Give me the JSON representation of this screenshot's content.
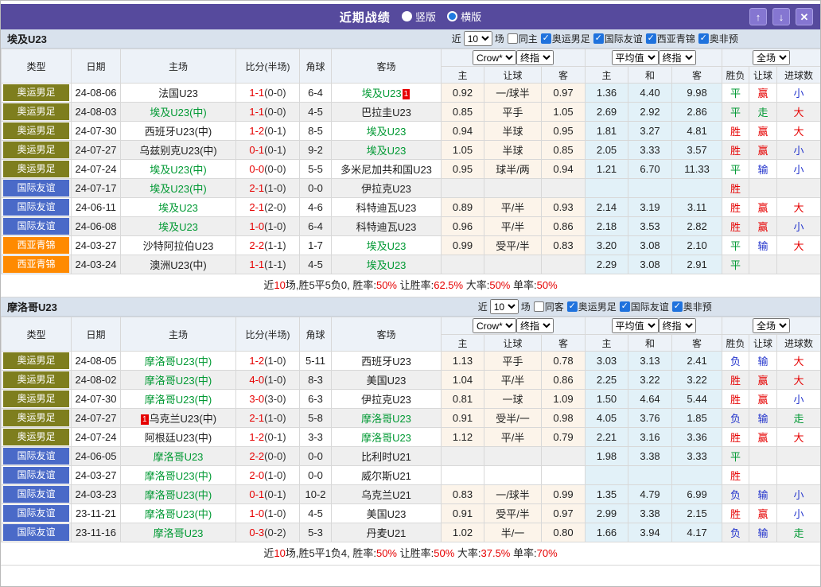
{
  "title_bar": {
    "title": "近期战绩",
    "radio_vertical": "竖版",
    "radio_horizontal": "横版",
    "up_icon": "↑",
    "down_icon": "↓",
    "close_icon": "✕"
  },
  "colors": {
    "titlebar_purple": "#564a9d",
    "button_purple": "#8576d1",
    "type_olympic": "#7e7e1e",
    "type_friendly": "#4a6ac8",
    "type_wasia": "#ff8a00",
    "team_green": "#009933",
    "score_red": "#e60000",
    "loss_blue": "#2233cc",
    "handicap_bg": "#fcf4ea",
    "avg_bg": "#e2f1f8"
  },
  "table_headers": {
    "type": "类型",
    "date": "日期",
    "home": "主场",
    "score": "比分(半场)",
    "corner": "角球",
    "away": "客场",
    "sub_home": "主",
    "sub_handicap": "让球",
    "sub_away": "客",
    "sub_home2": "主",
    "sub_draw": "和",
    "sub_away2": "客",
    "sub_result": "胜负",
    "sub_handicap2": "让球",
    "sub_goals": "进球数",
    "select_crow": "Crow*",
    "select_final_1": "终指",
    "select_avg": "平均值",
    "select_final_2": "终指",
    "select_full": "全场"
  },
  "sections": [
    {
      "team": "埃及U23",
      "filter": {
        "near_label": "近",
        "count": "10",
        "games_label": "场",
        "same_label": "同主",
        "same_checked": false,
        "competitions": [
          "奥运男足",
          "国际友谊",
          "西亚青锦",
          "奥非预"
        ]
      },
      "rows": [
        {
          "type": "奥运男足",
          "tc": "olive",
          "date": "24-08-06",
          "home": "法国U23",
          "hg": false,
          "hb": "",
          "score": "1-1",
          "half": "(0-0)",
          "corner": "6-4",
          "away": "埃及U23",
          "ag": true,
          "ab": "1",
          "odds": [
            "0.92",
            "一/球半",
            "0.97"
          ],
          "avg": [
            "1.36",
            "4.40",
            "9.98"
          ],
          "res": [
            [
              "平",
              "g"
            ],
            [
              "赢",
              "r"
            ],
            [
              "小",
              "b"
            ]
          ]
        },
        {
          "type": "奥运男足",
          "tc": "olive",
          "date": "24-08-03",
          "home": "埃及U23(中)",
          "hg": true,
          "hb": "",
          "score": "1-1",
          "half": "(0-0)",
          "corner": "4-5",
          "away": "巴拉圭U23",
          "ag": false,
          "ab": "",
          "odds": [
            "0.85",
            "平手",
            "1.05"
          ],
          "avg": [
            "2.69",
            "2.92",
            "2.86"
          ],
          "res": [
            [
              "平",
              "g"
            ],
            [
              "走",
              "g"
            ],
            [
              "大",
              "r"
            ]
          ]
        },
        {
          "type": "奥运男足",
          "tc": "olive",
          "date": "24-07-30",
          "home": "西班牙U23(中)",
          "hg": false,
          "hb": "",
          "score": "1-2",
          "half": "(0-1)",
          "corner": "8-5",
          "away": "埃及U23",
          "ag": true,
          "ab": "",
          "odds": [
            "0.94",
            "半球",
            "0.95"
          ],
          "avg": [
            "1.81",
            "3.27",
            "4.81"
          ],
          "res": [
            [
              "胜",
              "r"
            ],
            [
              "赢",
              "r"
            ],
            [
              "大",
              "r"
            ]
          ]
        },
        {
          "type": "奥运男足",
          "tc": "olive",
          "date": "24-07-27",
          "home": "乌兹别克U23(中)",
          "hg": false,
          "hb": "",
          "score": "0-1",
          "half": "(0-1)",
          "corner": "9-2",
          "away": "埃及U23",
          "ag": true,
          "ab": "",
          "odds": [
            "1.05",
            "半球",
            "0.85"
          ],
          "avg": [
            "2.05",
            "3.33",
            "3.57"
          ],
          "res": [
            [
              "胜",
              "r"
            ],
            [
              "赢",
              "r"
            ],
            [
              "小",
              "b"
            ]
          ]
        },
        {
          "type": "奥运男足",
          "tc": "olive",
          "date": "24-07-24",
          "home": "埃及U23(中)",
          "hg": true,
          "hb": "",
          "score": "0-0",
          "half": "(0-0)",
          "corner": "5-5",
          "away": "多米尼加共和国U23",
          "ag": false,
          "ab": "",
          "odds": [
            "0.95",
            "球半/两",
            "0.94"
          ],
          "avg": [
            "1.21",
            "6.70",
            "11.33"
          ],
          "res": [
            [
              "平",
              "g"
            ],
            [
              "输",
              "b"
            ],
            [
              "小",
              "b"
            ]
          ]
        },
        {
          "type": "国际友谊",
          "tc": "blue",
          "date": "24-07-17",
          "home": "埃及U23(中)",
          "hg": true,
          "hb": "",
          "score": "2-1",
          "half": "(1-0)",
          "corner": "0-0",
          "away": "伊拉克U23",
          "ag": false,
          "ab": "",
          "odds": [
            "",
            "",
            ""
          ],
          "avg": [
            "",
            "",
            ""
          ],
          "res": [
            [
              "胜",
              "r"
            ],
            [
              "",
              ""
            ],
            [
              "",
              ""
            ]
          ]
        },
        {
          "type": "国际友谊",
          "tc": "blue",
          "date": "24-06-11",
          "home": "埃及U23",
          "hg": true,
          "hb": "",
          "score": "2-1",
          "half": "(2-0)",
          "corner": "4-6",
          "away": "科特迪瓦U23",
          "ag": false,
          "ab": "",
          "odds": [
            "0.89",
            "平/半",
            "0.93"
          ],
          "avg": [
            "2.14",
            "3.19",
            "3.11"
          ],
          "res": [
            [
              "胜",
              "r"
            ],
            [
              "赢",
              "r"
            ],
            [
              "大",
              "r"
            ]
          ]
        },
        {
          "type": "国际友谊",
          "tc": "blue",
          "date": "24-06-08",
          "home": "埃及U23",
          "hg": true,
          "hb": "",
          "score": "1-0",
          "half": "(1-0)",
          "corner": "6-4",
          "away": "科特迪瓦U23",
          "ag": false,
          "ab": "",
          "odds": [
            "0.96",
            "平/半",
            "0.86"
          ],
          "avg": [
            "2.18",
            "3.53",
            "2.82"
          ],
          "res": [
            [
              "胜",
              "r"
            ],
            [
              "赢",
              "r"
            ],
            [
              "小",
              "b"
            ]
          ]
        },
        {
          "type": "西亚青锦",
          "tc": "orange",
          "date": "24-03-27",
          "home": "沙特阿拉伯U23",
          "hg": false,
          "hb": "",
          "score": "2-2",
          "half": "(1-1)",
          "corner": "1-7",
          "away": "埃及U23",
          "ag": true,
          "ab": "",
          "odds": [
            "0.99",
            "受平/半",
            "0.83"
          ],
          "avg": [
            "3.20",
            "3.08",
            "2.10"
          ],
          "res": [
            [
              "平",
              "g"
            ],
            [
              "输",
              "b"
            ],
            [
              "大",
              "r"
            ]
          ]
        },
        {
          "type": "西亚青锦",
          "tc": "orange",
          "date": "24-03-24",
          "home": "澳洲U23(中)",
          "hg": false,
          "hb": "",
          "score": "1-1",
          "half": "(1-1)",
          "corner": "4-5",
          "away": "埃及U23",
          "ag": true,
          "ab": "",
          "odds": [
            "",
            "",
            ""
          ],
          "avg": [
            "2.29",
            "3.08",
            "2.91"
          ],
          "res": [
            [
              "平",
              "g"
            ],
            [
              "",
              ""
            ],
            [
              "",
              ""
            ]
          ]
        }
      ],
      "summary_parts": [
        [
          "近",
          0
        ],
        [
          "10",
          1
        ],
        [
          "场,胜5平5负0, 胜率:",
          0
        ],
        [
          "50%",
          1
        ],
        [
          " 让胜率:",
          0
        ],
        [
          "62.5%",
          1
        ],
        [
          " 大率:",
          0
        ],
        [
          "50%",
          1
        ],
        [
          " 单率:",
          0
        ],
        [
          "50%",
          1
        ]
      ]
    },
    {
      "team": "摩洛哥U23",
      "filter": {
        "near_label": "近",
        "count": "10",
        "games_label": "场",
        "same_label": "同客",
        "same_checked": false,
        "competitions": [
          "奥运男足",
          "国际友谊",
          "奥非预"
        ]
      },
      "rows": [
        {
          "type": "奥运男足",
          "tc": "olive",
          "date": "24-08-05",
          "home": "摩洛哥U23(中)",
          "hg": true,
          "hb": "",
          "score": "1-2",
          "half": "(1-0)",
          "corner": "5-11",
          "away": "西班牙U23",
          "ag": false,
          "ab": "",
          "odds": [
            "1.13",
            "平手",
            "0.78"
          ],
          "avg": [
            "3.03",
            "3.13",
            "2.41"
          ],
          "res": [
            [
              "负",
              "b"
            ],
            [
              "输",
              "b"
            ],
            [
              "大",
              "r"
            ]
          ]
        },
        {
          "type": "奥运男足",
          "tc": "olive",
          "date": "24-08-02",
          "home": "摩洛哥U23(中)",
          "hg": true,
          "hb": "",
          "score": "4-0",
          "half": "(1-0)",
          "corner": "8-3",
          "away": "美国U23",
          "ag": false,
          "ab": "",
          "odds": [
            "1.04",
            "平/半",
            "0.86"
          ],
          "avg": [
            "2.25",
            "3.22",
            "3.22"
          ],
          "res": [
            [
              "胜",
              "r"
            ],
            [
              "赢",
              "r"
            ],
            [
              "大",
              "r"
            ]
          ]
        },
        {
          "type": "奥运男足",
          "tc": "olive",
          "date": "24-07-30",
          "home": "摩洛哥U23(中)",
          "hg": true,
          "hb": "",
          "score": "3-0",
          "half": "(3-0)",
          "corner": "6-3",
          "away": "伊拉克U23",
          "ag": false,
          "ab": "",
          "odds": [
            "0.81",
            "一球",
            "1.09"
          ],
          "avg": [
            "1.50",
            "4.64",
            "5.44"
          ],
          "res": [
            [
              "胜",
              "r"
            ],
            [
              "赢",
              "r"
            ],
            [
              "小",
              "b"
            ]
          ]
        },
        {
          "type": "奥运男足",
          "tc": "olive",
          "date": "24-07-27",
          "home": "乌克兰U23(中)",
          "hg": false,
          "hb": "1",
          "score": "2-1",
          "half": "(1-0)",
          "corner": "5-8",
          "away": "摩洛哥U23",
          "ag": true,
          "ab": "",
          "odds": [
            "0.91",
            "受半/一",
            "0.98"
          ],
          "avg": [
            "4.05",
            "3.76",
            "1.85"
          ],
          "res": [
            [
              "负",
              "b"
            ],
            [
              "输",
              "b"
            ],
            [
              "走",
              "g"
            ]
          ]
        },
        {
          "type": "奥运男足",
          "tc": "olive",
          "date": "24-07-24",
          "home": "阿根廷U23(中)",
          "hg": false,
          "hb": "",
          "score": "1-2",
          "half": "(0-1)",
          "corner": "3-3",
          "away": "摩洛哥U23",
          "ag": true,
          "ab": "",
          "odds": [
            "1.12",
            "平/半",
            "0.79"
          ],
          "avg": [
            "2.21",
            "3.16",
            "3.36"
          ],
          "res": [
            [
              "胜",
              "r"
            ],
            [
              "赢",
              "r"
            ],
            [
              "大",
              "r"
            ]
          ]
        },
        {
          "type": "国际友谊",
          "tc": "blue",
          "date": "24-06-05",
          "home": "摩洛哥U23",
          "hg": true,
          "hb": "",
          "score": "2-2",
          "half": "(0-0)",
          "corner": "0-0",
          "away": "比利时U21",
          "ag": false,
          "ab": "",
          "odds": [
            "",
            "",
            ""
          ],
          "avg": [
            "1.98",
            "3.38",
            "3.33"
          ],
          "res": [
            [
              "平",
              "g"
            ],
            [
              "",
              ""
            ],
            [
              "",
              ""
            ]
          ]
        },
        {
          "type": "国际友谊",
          "tc": "blue",
          "date": "24-03-27",
          "home": "摩洛哥U23(中)",
          "hg": true,
          "hb": "",
          "score": "2-0",
          "half": "(1-0)",
          "corner": "0-0",
          "away": "威尔斯U21",
          "ag": false,
          "ab": "",
          "odds": [
            "",
            "",
            ""
          ],
          "avg": [
            "",
            "",
            ""
          ],
          "res": [
            [
              "胜",
              "r"
            ],
            [
              "",
              ""
            ],
            [
              "",
              ""
            ]
          ]
        },
        {
          "type": "国际友谊",
          "tc": "blue",
          "date": "24-03-23",
          "home": "摩洛哥U23(中)",
          "hg": true,
          "hb": "",
          "score": "0-1",
          "half": "(0-1)",
          "corner": "10-2",
          "away": "乌克兰U21",
          "ag": false,
          "ab": "",
          "odds": [
            "0.83",
            "一/球半",
            "0.99"
          ],
          "avg": [
            "1.35",
            "4.79",
            "6.99"
          ],
          "res": [
            [
              "负",
              "b"
            ],
            [
              "输",
              "b"
            ],
            [
              "小",
              "b"
            ]
          ]
        },
        {
          "type": "国际友谊",
          "tc": "blue",
          "date": "23-11-21",
          "home": "摩洛哥U23(中)",
          "hg": true,
          "hb": "",
          "score": "1-0",
          "half": "(1-0)",
          "corner": "4-5",
          "away": "美国U23",
          "ag": false,
          "ab": "",
          "odds": [
            "0.91",
            "受平/半",
            "0.97"
          ],
          "avg": [
            "2.99",
            "3.38",
            "2.15"
          ],
          "res": [
            [
              "胜",
              "r"
            ],
            [
              "赢",
              "r"
            ],
            [
              "小",
              "b"
            ]
          ]
        },
        {
          "type": "国际友谊",
          "tc": "blue",
          "date": "23-11-16",
          "home": "摩洛哥U23",
          "hg": true,
          "hb": "",
          "score": "0-3",
          "half": "(0-2)",
          "corner": "5-3",
          "away": "丹麦U21",
          "ag": false,
          "ab": "",
          "odds": [
            "1.02",
            "半/一",
            "0.80"
          ],
          "avg": [
            "1.66",
            "3.94",
            "4.17"
          ],
          "res": [
            [
              "负",
              "b"
            ],
            [
              "输",
              "b"
            ],
            [
              "走",
              "g"
            ]
          ]
        }
      ],
      "summary_parts": [
        [
          "近",
          0
        ],
        [
          "10",
          1
        ],
        [
          "场,胜5平1负4, 胜率:",
          0
        ],
        [
          "50%",
          1
        ],
        [
          " 让胜率:",
          0
        ],
        [
          "50%",
          1
        ],
        [
          " 大率:",
          0
        ],
        [
          "37.5%",
          1
        ],
        [
          " 单率:",
          0
        ],
        [
          "70%",
          1
        ]
      ]
    }
  ]
}
